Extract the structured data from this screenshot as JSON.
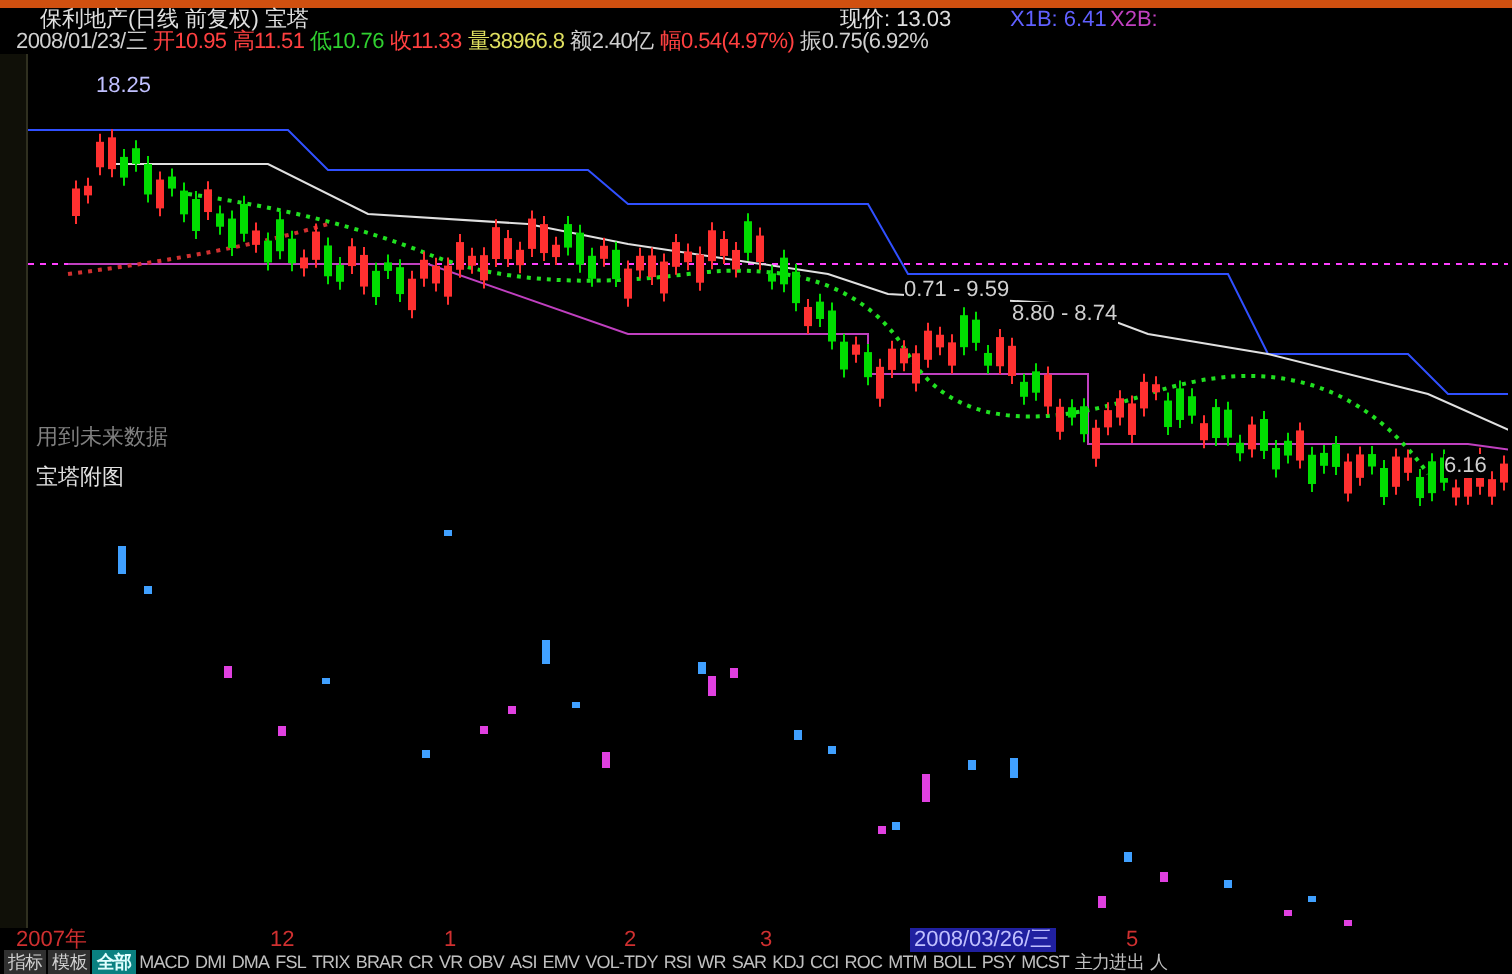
{
  "header": {
    "title": "保利地产(日线 前复权) 宝塔",
    "price": "现价: 13.03",
    "x1b": "X1B: 6.41",
    "x2b": "X2B:"
  },
  "quote": [
    {
      "text": "2008/01/23/三",
      "color": "#d0d0d0"
    },
    {
      "text": "开10.95",
      "color": "#ff4040"
    },
    {
      "text": "高11.51",
      "color": "#ff4040"
    },
    {
      "text": "低10.76",
      "color": "#30d030"
    },
    {
      "text": "收11.33",
      "color": "#ff4040"
    },
    {
      "text": "量38966.8",
      "color": "#e0e060"
    },
    {
      "text": "额2.40亿",
      "color": "#d0d0d0"
    },
    {
      "text": "幅0.54(4.97%)",
      "color": "#ff4040"
    },
    {
      "text": "振0.75(6.92%",
      "color": "#d0d0d0"
    }
  ],
  "chart_labels": [
    "18.25",
    "0.71 - 9.59",
    "8.80 - 8.74",
    "6.16"
  ],
  "notice": "用到未来数据",
  "subchart_title": "宝塔附图",
  "axis": [
    {
      "text": "2007年",
      "selected": false
    },
    {
      "text": "12",
      "selected": false
    },
    {
      "text": "1",
      "selected": false
    },
    {
      "text": "2",
      "selected": false
    },
    {
      "text": "3",
      "selected": false
    },
    {
      "text": "2008/03/26/三",
      "selected": true
    },
    {
      "text": "5",
      "selected": false
    }
  ],
  "tabs": [
    {
      "label": "指标",
      "selected": false,
      "kind": "menu"
    },
    {
      "label": "模板",
      "selected": false,
      "kind": "menu"
    },
    {
      "label": "全部",
      "selected": true,
      "kind": "group"
    },
    {
      "label": "MACD",
      "selected": false,
      "kind": "indicator"
    },
    {
      "label": "DMI",
      "selected": false,
      "kind": "indicator"
    },
    {
      "label": "DMA",
      "selected": false,
      "kind": "indicator"
    },
    {
      "label": "FSL",
      "selected": false,
      "kind": "indicator"
    },
    {
      "label": "TRIX",
      "selected": false,
      "kind": "indicator"
    },
    {
      "label": "BRAR",
      "selected": false,
      "kind": "indicator"
    },
    {
      "label": "CR",
      "selected": false,
      "kind": "indicator"
    },
    {
      "label": "VR",
      "selected": false,
      "kind": "indicator"
    },
    {
      "label": "OBV",
      "selected": false,
      "kind": "indicator"
    },
    {
      "label": "ASI",
      "selected": false,
      "kind": "indicator"
    },
    {
      "label": "EMV",
      "selected": false,
      "kind": "indicator"
    },
    {
      "label": "VOL-TDY",
      "selected": false,
      "kind": "indicator"
    },
    {
      "label": "RSI",
      "selected": false,
      "kind": "indicator"
    },
    {
      "label": "WR",
      "selected": false,
      "kind": "indicator"
    },
    {
      "label": "SAR",
      "selected": false,
      "kind": "indicator"
    },
    {
      "label": "KDJ",
      "selected": false,
      "kind": "indicator"
    },
    {
      "label": "CCI",
      "selected": false,
      "kind": "indicator"
    },
    {
      "label": "ROC",
      "selected": false,
      "kind": "indicator"
    },
    {
      "label": "MTM",
      "selected": false,
      "kind": "indicator"
    },
    {
      "label": "BOLL",
      "selected": false,
      "kind": "indicator"
    },
    {
      "label": "PSY",
      "selected": false,
      "kind": "indicator"
    },
    {
      "label": "MCST",
      "selected": false,
      "kind": "indicator"
    },
    {
      "label": "主力进出",
      "selected": false,
      "kind": "indicator"
    },
    {
      "label": "人",
      "selected": false,
      "kind": "indicator"
    }
  ]
}
